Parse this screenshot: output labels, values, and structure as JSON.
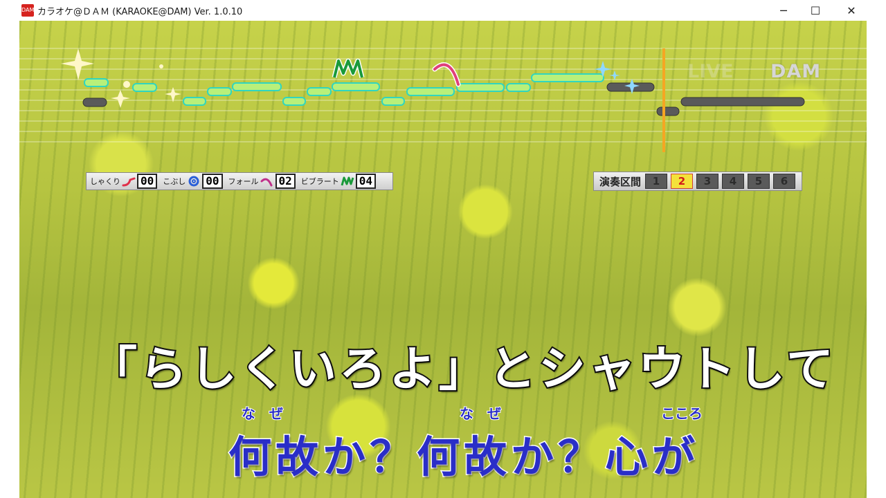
{
  "window": {
    "title": "カラオケ@ＤＡＭ (KARAOKE@DAM) Ver. 1.0.10",
    "app_icon_text": "DAM",
    "minimize_glyph": "─",
    "maximize_glyph": "☐",
    "close_glyph": "✕"
  },
  "overlay": {
    "live_text": "LIVE",
    "logo_text": "DAM"
  },
  "techniques": {
    "shakuri_label": "しゃくり",
    "shakuri_count": "00",
    "kobushi_label": "こぶし",
    "kobushi_count": "00",
    "fall_label": "フォール",
    "fall_count": "02",
    "vibrato_label": "ビブラート",
    "vibrato_count": "04",
    "vibrato_marker": "M",
    "colors": {
      "shakuri": "#e0304a",
      "kobushi": "#2a5fd8",
      "fall": "#c0308a",
      "vibrato": "#1a9a3a"
    }
  },
  "section": {
    "label": "演奏区間",
    "cells": [
      "1",
      "2",
      "3",
      "4",
      "5",
      "6"
    ],
    "active": "2"
  },
  "lyrics": {
    "line1": "「らしくいろよ」とシャウトして",
    "line2": "何故か？何故か？心が",
    "ruby1": "な　ぜ",
    "ruby2": "な　ぜ",
    "ruby3": "こころ"
  },
  "colors": {
    "sung_bar": "#b8f07a",
    "sung_bar_outline": "#2fd6c0",
    "upcoming_bar": "#5a5a5a",
    "playhead": "#f5a623",
    "lyric_upcoming": "#2a2ec8"
  }
}
